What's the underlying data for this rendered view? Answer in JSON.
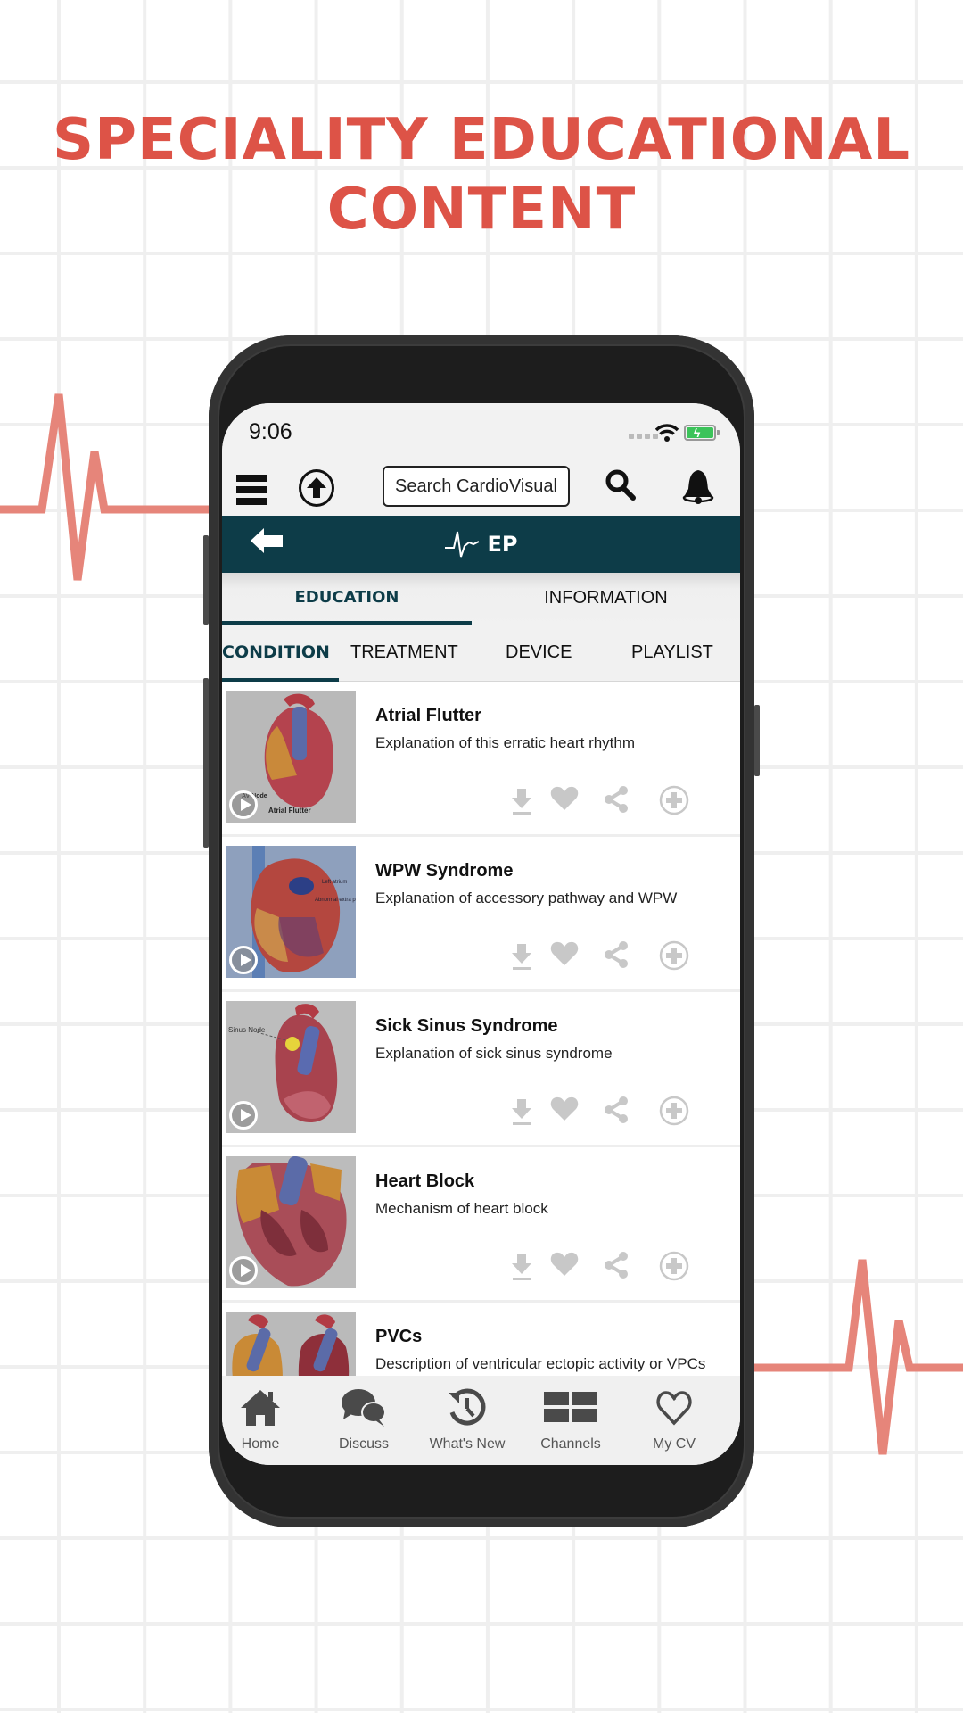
{
  "headline": {
    "line1": "SPECIALITY EDUCATIONAL",
    "line2": "CONTENT",
    "color": "#dd5347"
  },
  "status_bar": {
    "time": "9:06",
    "icons": [
      "signal-dots-icon",
      "wifi-icon",
      "battery-charging-icon"
    ]
  },
  "toolbar": {
    "menu_icon": "hamburger-menu-icon",
    "upload_icon": "upload-arrow-icon",
    "search_placeholder": "Search CardioVisual",
    "search_icon": "search-icon",
    "notification_icon": "bell-icon"
  },
  "header": {
    "back_icon": "back-arrow-icon",
    "title_icon": "ecg-pulse-icon",
    "title": "EP",
    "color": "#0d3c48"
  },
  "main_tabs": [
    {
      "label": "EDUCATION",
      "active": true
    },
    {
      "label": "INFORMATION",
      "active": false
    }
  ],
  "sub_tabs": [
    {
      "label": "CONDITION",
      "active": true
    },
    {
      "label": "TREATMENT",
      "active": false
    },
    {
      "label": "DEVICE",
      "active": false
    },
    {
      "label": "PLAYLIST",
      "active": false
    }
  ],
  "items": [
    {
      "title": "Atrial Flutter",
      "description": "Explanation of this erratic heart rhythm",
      "thumb_labels": [
        "AV Node",
        "Atrial Flutter"
      ]
    },
    {
      "title": "WPW Syndrome",
      "description": "Explanation of accessory pathway and WPW",
      "thumb_labels": [
        "Left atrium",
        "Abnormal extra pathway"
      ]
    },
    {
      "title": "Sick Sinus Syndrome",
      "description": "Explanation of sick sinus syndrome",
      "thumb_labels": [
        "Sinus Node"
      ]
    },
    {
      "title": "Heart Block",
      "description": "Mechanism of heart block",
      "thumb_labels": []
    },
    {
      "title": "PVCs",
      "description": "Description of ventricular ectopic activity or VPCs",
      "thumb_labels": []
    }
  ],
  "item_actions": [
    "download-icon",
    "heart-icon",
    "share-icon",
    "add-circle-icon"
  ],
  "bottom_nav": [
    {
      "label": "Home",
      "icon": "home-icon"
    },
    {
      "label": "Discuss",
      "icon": "chat-bubbles-icon"
    },
    {
      "label": "What's New",
      "icon": "history-clock-icon"
    },
    {
      "label": "Channels",
      "icon": "grid-icon"
    },
    {
      "label": "My CV",
      "icon": "heart-outline-icon"
    }
  ]
}
